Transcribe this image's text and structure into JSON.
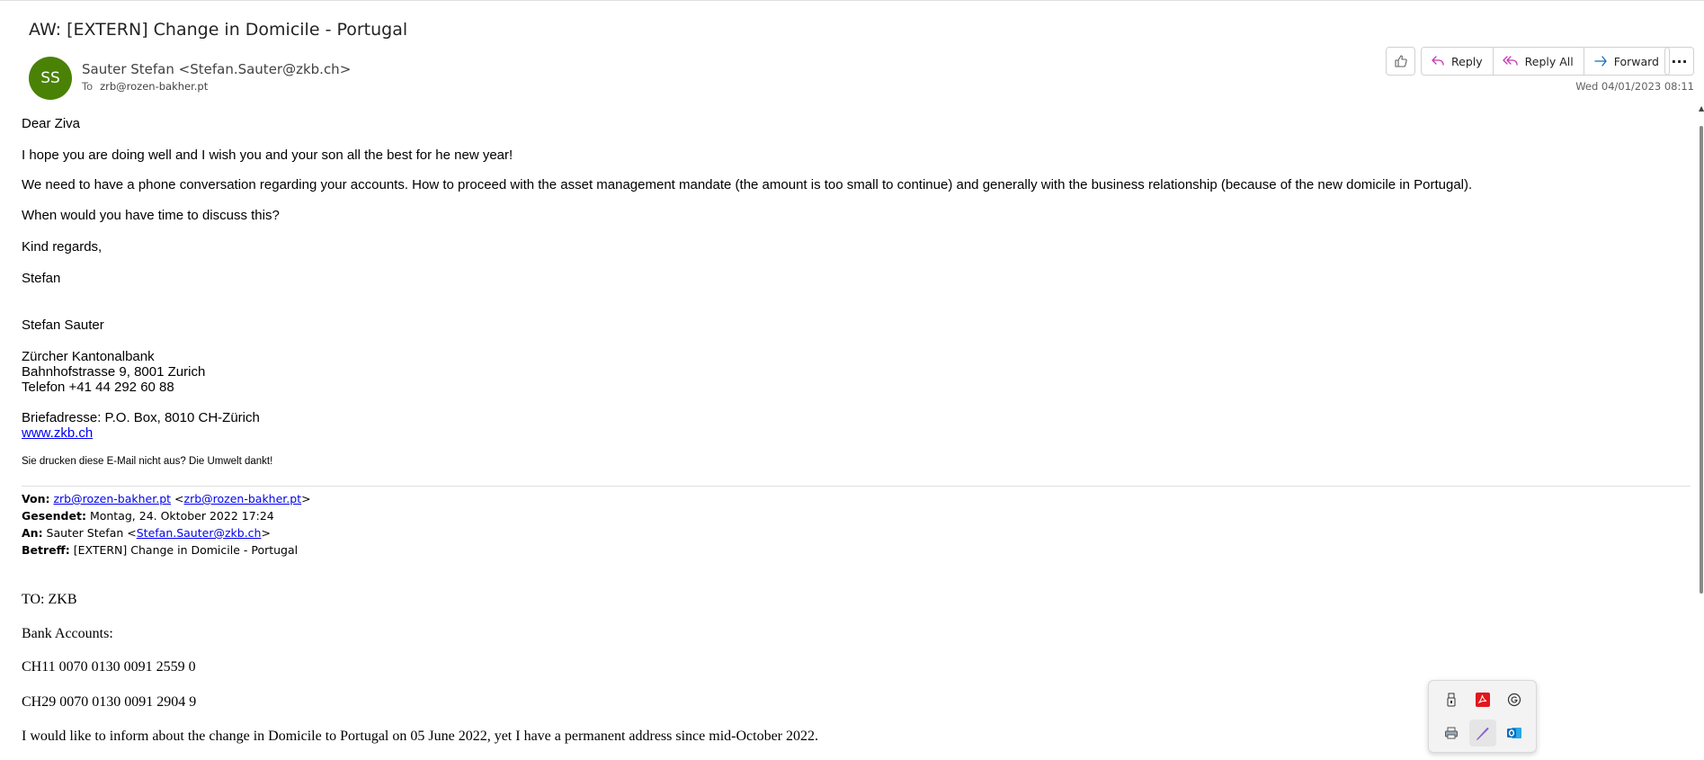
{
  "email": {
    "subject": "AW: [EXTERN] Change in Domicile - Portugal",
    "avatar_initials": "SS",
    "sender": "Sauter Stefan <Stefan.Sauter@zkb.ch>",
    "to_label": "To",
    "to_address": "zrb@rozen-bakher.pt",
    "date": "Wed 04/01/2023 08:11"
  },
  "actions": {
    "reply": "Reply",
    "reply_all": "Reply All",
    "forward": "Forward",
    "more": "···"
  },
  "body": {
    "greeting": "Dear Ziva",
    "p1": "I hope you are doing well and I wish you and your son all the best for he new year!",
    "p2": "We need to have a phone conversation regarding your accounts. How to proceed with the asset management mandate (the amount is too small to continue) and generally with the business relationship (because of the new domicile in Portugal).",
    "p3": "When would you have time to discuss this?",
    "closing": "Kind regards,",
    "name": "Stefan"
  },
  "signature": {
    "name": "Stefan Sauter",
    "bank": "Zürcher Kantonalbank",
    "street": "Bahnhofstrasse 9, 8001 Zurich",
    "phone": "Telefon +41 44 292 60 88",
    "postal": "Briefadresse: P.O. Box, 8010 CH-Zürich",
    "website": "www.zkb.ch",
    "print_note": "Sie drucken diese E-Mail nicht aus? Die Umwelt dankt!"
  },
  "quoted_header": {
    "from_label": "Von:",
    "from_link1": "zrb@rozen-bakher.pt",
    "from_open": " <",
    "from_link2": "zrb@rozen-bakher.pt",
    "from_close": ">",
    "sent_label": "Gesendet:",
    "sent_value": " Montag, 24. Oktober 2022 17:24",
    "to_label": "An:",
    "to_value": " Sauter Stefan <",
    "to_link": "Stefan.Sauter@zkb.ch",
    "to_close": ">",
    "subject_label": "Betreff:",
    "subject_value": " [EXTERN] Change in Domicile - Portugal"
  },
  "quoted_body": {
    "to": "TO: ZKB",
    "accounts_label": "Bank Accounts:",
    "account1": "CH11 0070 0130 0091 2559 0",
    "account2": "CH29 0070 0130 0091 2904 9",
    "info": "I would like to inform about the change in Domicile to Portugal on 05 June 2022, yet I have a permanent address since mid-October 2022."
  },
  "colors": {
    "avatar_bg": "#498205",
    "link": "#0000ee",
    "reply_icon": "#c239b3",
    "forward_icon": "#0f6cbd"
  },
  "tray_icons": [
    "usb-drive-icon",
    "acrobat-icon",
    "grammarly-icon",
    "printer-icon",
    "pen-icon",
    "outlook-icon"
  ]
}
